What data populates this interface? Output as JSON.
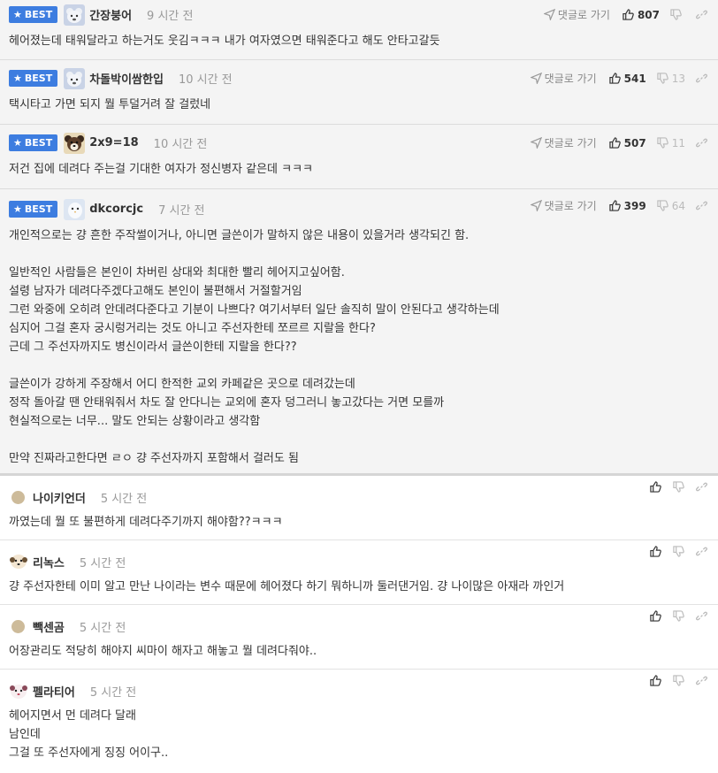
{
  "common": {
    "goto_label": "댓글로 가기",
    "best_label": "BEST"
  },
  "best_comments": [
    {
      "nick": "간장붕어",
      "time": "9 시간 전",
      "up": "807",
      "down": "",
      "show_goto": true,
      "avatar": "bear",
      "lines": [
        "헤어졌는데 태워달라고 하는거도 웃김ㅋㅋㅋ 내가 여자였으면 태워준다고 해도 안타고갈듯"
      ]
    },
    {
      "nick": "차돌박이쌈한입",
      "time": "10 시간 전",
      "up": "541",
      "down": "13",
      "show_goto": true,
      "avatar": "bear",
      "lines": [
        "택시타고 가면 되지 뭘 투덜거려 잘 걸렀네"
      ]
    },
    {
      "nick": "2x9=18",
      "time": "10 시간 전",
      "up": "507",
      "down": "11",
      "show_goto": true,
      "avatar": "dog",
      "lines": [
        "저건 집에 데려다 주는걸 기대한 여자가 정신병자 같은데 ㅋㅋㅋ"
      ]
    },
    {
      "nick": "dkcorcjc",
      "time": "7 시간 전",
      "up": "399",
      "down": "64",
      "show_goto": true,
      "avatar": "bird",
      "lines": [
        "개인적으로는 걍 흔한 주작썰이거나, 아니면 글쓴이가 말하지 않은 내용이 있을거라 생각되긴 함.",
        "",
        "일반적인 사람들은 본인이 차버린 상대와 최대한 빨리 헤어지고싶어함.",
        "설령 남자가 데려다주겠다고해도 본인이 불편해서 거절할거임",
        "그런 와중에 오히려 안데려다준다고 기분이 나쁘다? 여기서부터 일단 솔직히 말이 안된다고 생각하는데",
        "심지어 그걸 혼자 궁시렁거리는 것도 아니고 주선자한테 쪼르르 지랄을 한다?",
        "근데 그 주선자까지도 병신이라서 글쓴이한테 지랄을 한다??",
        "",
        "글쓴이가 강하게 주장해서 어디 한적한 교외 카페같은 곳으로 데려갔는데",
        "정작 돌아갈 땐 안태워줘서 차도 잘 안다니는 교외에 혼자 덩그러니 놓고갔다는 거면 모를까",
        "현실적으로는 너무... 말도 안되는 상황이라고 생각함",
        "",
        "만약 진짜라고한다면 ㄹㅇ 걍 주선자까지 포함해서 걸러도 됨"
      ]
    }
  ],
  "comments": [
    {
      "nick": "나이키언더",
      "time": "5 시간 전",
      "avatar": "dot",
      "lines": [
        "까였는데 뭘 또 불편하게 데려다주기까지 해야함??ㅋㅋㅋ"
      ]
    },
    {
      "nick": "리녹스",
      "time": "5 시간 전",
      "avatar": "pup",
      "lines": [
        "걍 주선자한테 이미 알고 만난 나이라는 변수 때문에 헤어졌다 하기 뭐하니까 둘러댄거임. 걍 나이많은 아재라 까인거"
      ]
    },
    {
      "nick": "빽센곰",
      "time": "5 시간 전",
      "avatar": "dot",
      "lines": [
        "어장관리도 적당히 해야지 씨마이 해자고 해놓고 뭘 데려다줘야.."
      ]
    },
    {
      "nick": "펠라티어",
      "time": "5 시간 전",
      "avatar": "pup2",
      "lines": [
        "헤어지면서 먼 데려다 달래",
        "남인데",
        "그걸 또 주선자에게 징징 어이구.."
      ]
    }
  ]
}
